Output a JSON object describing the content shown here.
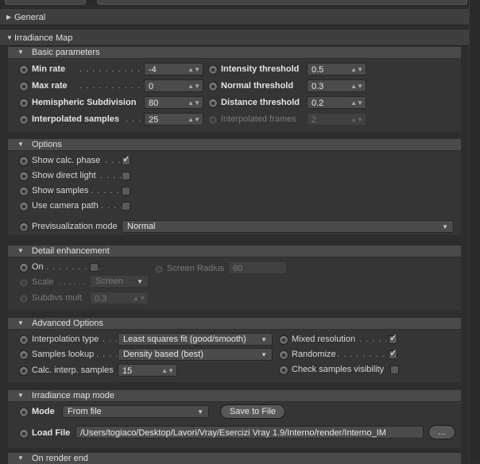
{
  "sections": {
    "general": "General",
    "irradiance_map": "Irradiance Map",
    "basic_parameters": "Basic parameters",
    "options": "Options",
    "detail_enhancement": "Detail enhancement",
    "advanced_options": "Advanced Options",
    "irradiance_map_mode": "Irradiance map mode",
    "on_render_end": "On render end"
  },
  "basic": {
    "min_rate": {
      "label": "Min rate",
      "dots": ". . . . . . . . . . . . . .",
      "value": "-4"
    },
    "max_rate": {
      "label": "Max rate",
      "dots": ". . . . . . . . . . . . . .",
      "value": "0"
    },
    "hemispheric": {
      "label": "Hemispheric Subdivision",
      "value": "80"
    },
    "interpolated_samples": {
      "label": "Interpolated samples",
      "dots": ". . .",
      "value": "25"
    },
    "intensity_threshold": {
      "label": "Intensity threshold",
      "value": "0.5"
    },
    "normal_threshold": {
      "label": "Normal threshold",
      "value": "0.3"
    },
    "distance_threshold": {
      "label": "Distance threshold",
      "value": "0.2"
    },
    "interpolated_frames": {
      "label": "Interpolated frames",
      "value": "2"
    }
  },
  "options": {
    "show_calc_phase": {
      "label": "Show calc. phase",
      "dots": ". . .",
      "checked": true
    },
    "show_direct_light": {
      "label": "Show direct light",
      "dots": ". . . .",
      "checked": false
    },
    "show_samples": {
      "label": "Show samples",
      "dots": ". . . . . .",
      "checked": false
    },
    "use_camera_path": {
      "label": "Use camera path",
      "dots": ". . . .",
      "checked": false
    },
    "previs_mode": {
      "label": "Previsualization mode",
      "value": "Normal"
    }
  },
  "detail": {
    "on": {
      "label": "On",
      "dots": ". . . . . . . . .",
      "checked": false
    },
    "screen_radius": {
      "label": "Screen Radius",
      "value": "60"
    },
    "scale": {
      "label": "Scale",
      "dots": ". . . . . .",
      "value": "Screen"
    },
    "subdivs_mult": {
      "label": "Subdivs mult.",
      "value": "0.3"
    }
  },
  "advanced": {
    "interpolation_type": {
      "label": "Interpolation type",
      "dots": ". . .",
      "value": "Least squares fit (good/smooth)"
    },
    "samples_lookup": {
      "label": "Samples lookup",
      "dots": ". . . .",
      "value": "Density based (best)"
    },
    "calc_interp_samples": {
      "label": "Calc. interp. samples",
      "value": "15"
    },
    "mixed_resolution": {
      "label": "Mixed resolution",
      "dots": ". . . . .",
      "checked": true
    },
    "randomize": {
      "label": "Randomize",
      "dots": ". . . . . . . . . .",
      "checked": true
    },
    "check_visibility": {
      "label": "Check samples visibility",
      "checked": false
    }
  },
  "mode": {
    "mode_label": "Mode",
    "mode_value": "From file",
    "save_button": "Save to File",
    "load_label": "Load File",
    "load_path": "/Users/togiaco/Desktop/Lavori/Vray/Esercizi Vray 1.9/Interno/render/Interno_IM",
    "browse_button": "..."
  },
  "icons": {
    "expanded": "triangle-down",
    "collapsed": "triangle-right",
    "spinner": "up-down-arrows",
    "check": "checkmark"
  }
}
